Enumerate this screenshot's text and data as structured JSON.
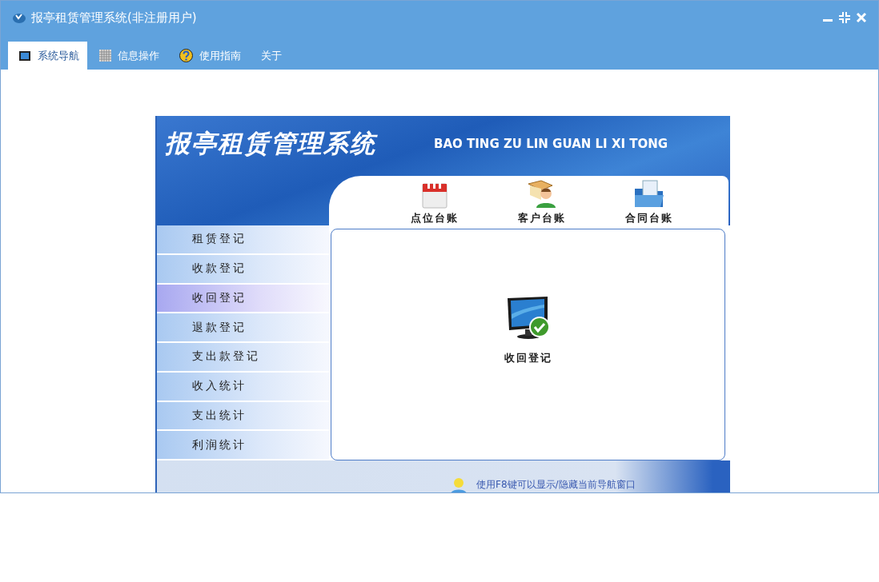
{
  "window": {
    "title": "报亭租赁管理系统(非注册用户)"
  },
  "tabs": [
    {
      "label": "系统导航",
      "selected": true
    },
    {
      "label": "信息操作",
      "selected": false
    },
    {
      "label": "使用指南",
      "selected": false
    },
    {
      "label": "关于",
      "selected": false
    }
  ],
  "banner": {
    "title": "报亭租赁管理系统",
    "subtitle": "BAO TING ZU LIN GUAN LI XI TONG"
  },
  "shortcuts": [
    "点位台账",
    "客户台账",
    "合同台账"
  ],
  "menu": [
    {
      "label": "租赁登记",
      "selected": false
    },
    {
      "label": "收款登记",
      "selected": false
    },
    {
      "label": "收回登记",
      "selected": true
    },
    {
      "label": "退款登记",
      "selected": false
    },
    {
      "label": "支出款登记",
      "selected": false
    },
    {
      "label": "收入统计",
      "selected": false
    },
    {
      "label": "支出统计",
      "selected": false
    },
    {
      "label": "利润统计",
      "selected": false
    }
  ],
  "content": {
    "title": "收回登记"
  },
  "hint": "使用F8键可以显示/隐藏当前导航窗口"
}
